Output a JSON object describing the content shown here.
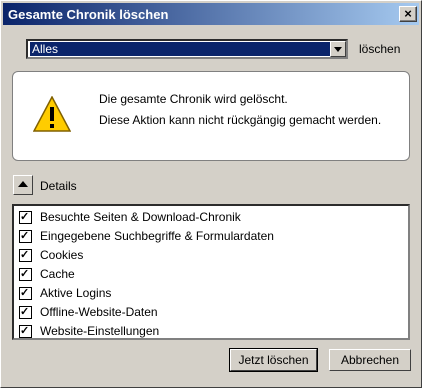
{
  "window": {
    "title": "Gesamte Chronik löschen",
    "close_icon": "close-icon"
  },
  "time_range": {
    "selected": "Alles",
    "label": "löschen"
  },
  "warning": {
    "icon": "warning-icon",
    "line1": "Die gesamte Chronik wird gelöscht.",
    "line2": "Diese Aktion kann nicht rückgängig gemacht werden."
  },
  "details": {
    "label": "Details",
    "toggle_icon": "chevron-up-icon"
  },
  "items": [
    {
      "label": "Besuchte Seiten & Download-Chronik",
      "checked": true
    },
    {
      "label": "Eingegebene Suchbegriffe & Formulardaten",
      "checked": true
    },
    {
      "label": "Cookies",
      "checked": true
    },
    {
      "label": "Cache",
      "checked": true
    },
    {
      "label": "Aktive Logins",
      "checked": true
    },
    {
      "label": "Offline-Website-Daten",
      "checked": true
    },
    {
      "label": "Website-Einstellungen",
      "checked": true
    }
  ],
  "buttons": {
    "clear": "Jetzt löschen",
    "cancel": "Abbrechen"
  }
}
